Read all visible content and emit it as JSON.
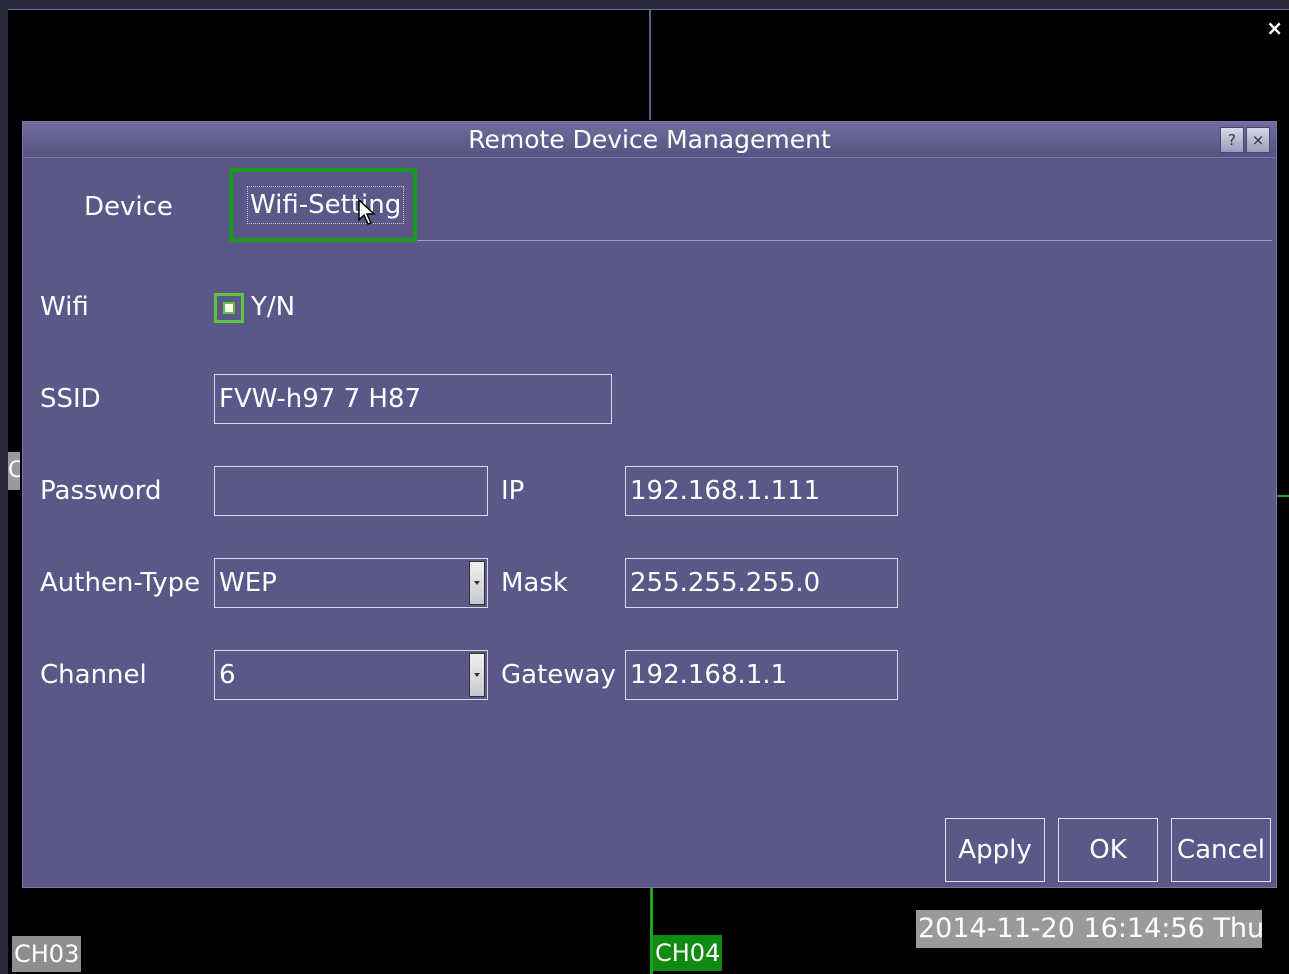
{
  "screen": {
    "close_glyph": "×",
    "channels": {
      "ch03": "CH03",
      "ch04": "CH04"
    },
    "left_stub_text": "C",
    "datetime": "2014-11-20 16:14:56 Thu"
  },
  "dialog": {
    "title": "Remote Device Management",
    "help_glyph": "?",
    "close_glyph": "×",
    "tabs": [
      {
        "label": "Device",
        "active": false
      },
      {
        "label": "Wifi-Setting",
        "active": true
      }
    ],
    "wifi": {
      "label": "Wifi",
      "checkbox_label": "Y/N",
      "checked": true
    },
    "ssid": {
      "label": "SSID",
      "value": "FVW-h97 7 H87"
    },
    "password": {
      "label": "Password",
      "value": ""
    },
    "authen_type": {
      "label": "Authen-Type",
      "value": "WEP"
    },
    "channel": {
      "label": "Channel",
      "value": "6"
    },
    "ip": {
      "label": "IP",
      "value": "192.168.1.111"
    },
    "mask": {
      "label": "Mask",
      "value": "255.255.255.0"
    },
    "gateway": {
      "label": "Gateway",
      "value": "192.168.1.1"
    },
    "buttons": {
      "apply": "Apply",
      "ok": "OK",
      "cancel": "Cancel"
    }
  },
  "colors": {
    "dialog_bg": "#5a5888",
    "focus_green": "#1a9a1a",
    "checkbox_green": "#5fc53a",
    "ch04_bg": "#118a11"
  }
}
